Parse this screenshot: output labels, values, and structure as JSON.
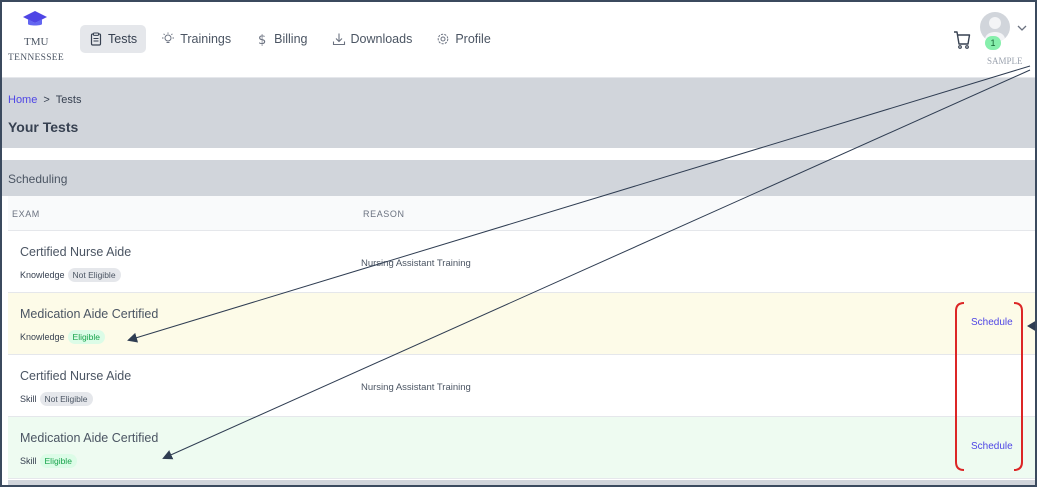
{
  "brand": {
    "line1": "TMU",
    "line2": "TENNESSEE"
  },
  "nav": {
    "items": [
      {
        "label": "Tests",
        "icon": "clipboard-icon",
        "active": true
      },
      {
        "label": "Trainings",
        "icon": "lightbulb-icon",
        "active": false
      },
      {
        "label": "Billing",
        "icon": "dollar-icon",
        "active": false
      },
      {
        "label": "Downloads",
        "icon": "download-icon",
        "active": false
      },
      {
        "label": "Profile",
        "icon": "gear-icon",
        "active": false
      }
    ]
  },
  "user": {
    "cart_count": "1",
    "watermark": "SAMPLE"
  },
  "breadcrumb": {
    "home": "Home",
    "separator": ">",
    "current": "Tests"
  },
  "page": {
    "title": "Your Tests"
  },
  "section": {
    "title": "Scheduling"
  },
  "table": {
    "columns": [
      "EXAM",
      "REASON"
    ],
    "rows": [
      {
        "exam": "Certified Nurse Aide",
        "type": "Knowledge",
        "status": "Not Eligible",
        "reason": "Nursing Assistant Training",
        "action": ""
      },
      {
        "exam": "Medication Aide Certified",
        "type": "Knowledge",
        "status": "Eligible",
        "reason": "",
        "action": "Schedule"
      },
      {
        "exam": "Certified Nurse Aide",
        "type": "Skill",
        "status": "Not Eligible",
        "reason": "Nursing Assistant Training",
        "action": ""
      },
      {
        "exam": "Medication Aide Certified",
        "type": "Skill",
        "status": "Eligible",
        "reason": "",
        "action": "Schedule"
      }
    ]
  },
  "colors": {
    "accent": "#4f46e5",
    "eligible": "#16a34a",
    "annotation_arrow": "#2f3d52",
    "annotation_bracket": "#dc2626"
  }
}
